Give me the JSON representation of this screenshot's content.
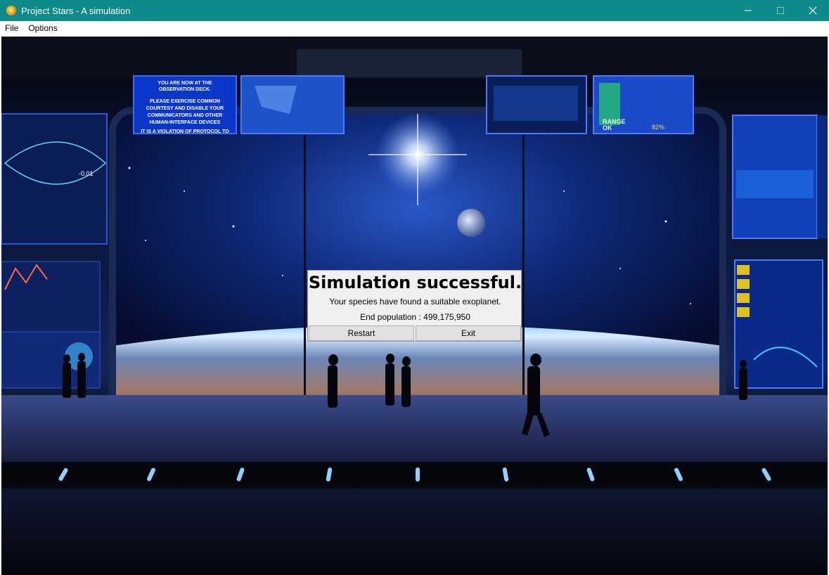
{
  "window": {
    "title": "Project Stars - A simulation",
    "icon": "sun-icon",
    "controls": [
      "minimize-icon",
      "maximize-icon",
      "close-icon"
    ]
  },
  "menu": {
    "items": [
      {
        "label": "File"
      },
      {
        "label": "Options"
      }
    ]
  },
  "scene": {
    "description_icon": "observation-deck-image",
    "screens": {
      "left_top_text": [
        "YOU ARE NOW AT THE",
        "OBSERVATION DECK.",
        "PLEASE EXERCISE COMMON",
        "COURTESY AND DISABLE YOUR",
        "COMMUNICATORS AND OTHER",
        "HUMAN-INTERFACE DEVICES",
        "IT IS A VIOLATION OF PROTOCOL TO"
      ],
      "left_panel_value": "-0.01",
      "right_panel_text": [
        "RANGE",
        "OK"
      ],
      "right_panel_percent": "82%"
    }
  },
  "dialog": {
    "title": "Simulation successful.",
    "message": "Your species have found a suitable exoplanet.",
    "population": "End population : 499,175,950",
    "restart_label": "Restart",
    "exit_label": "Exit"
  },
  "colors": {
    "titlebar": "#0f8a8a",
    "dialog_bg": "#f0f0f0",
    "button_bg": "#e1e1e1"
  }
}
